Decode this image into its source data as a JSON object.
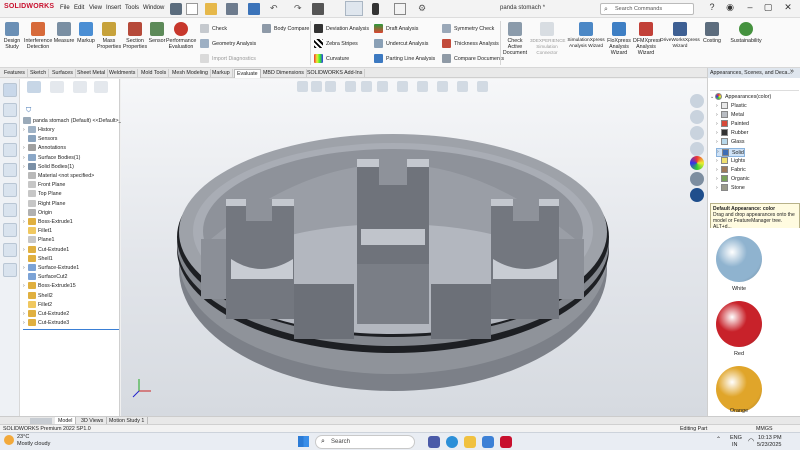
{
  "titlebar": {
    "logo": "SOLIDWORKS",
    "menus": [
      "File",
      "Edit",
      "View",
      "Insert",
      "Tools",
      "Window"
    ],
    "document_title": "panda stomach *",
    "search_placeholder": "Search Commands"
  },
  "ribbon": {
    "large_buttons": [
      {
        "label": "Design\nStudy",
        "icon": "design-study-icon"
      },
      {
        "label": "Interference\nDetection",
        "icon": "interference-icon"
      },
      {
        "label": "Measure",
        "icon": "measure-icon"
      },
      {
        "label": "Markup",
        "icon": "markup-icon"
      },
      {
        "label": "Mass\nProperties",
        "icon": "mass-properties-icon"
      },
      {
        "label": "Section\nProperties",
        "icon": "section-properties-icon"
      },
      {
        "label": "Sensor",
        "icon": "sensor-icon"
      },
      {
        "label": "Performance\nEvaluation",
        "icon": "performance-icon"
      }
    ],
    "small_col1": [
      "Check",
      "Geometry Analysis",
      "Import Diagnostics"
    ],
    "body_compare": "Body Compare",
    "small_col2": [
      "Deviation Analysis",
      "Zebra Stripes",
      "Curvature"
    ],
    "small_col3": [
      "Draft Analysis",
      "Undercut Analysis",
      "Parting Line Analysis"
    ],
    "small_col4": [
      "Symmetry Check",
      "Thickness Analysis",
      "Compare Documents"
    ],
    "large_buttons2": [
      {
        "label": "Check\nActive\nDocument",
        "icon": "check-active-icon"
      },
      {
        "label": "3DEXPERIENCE\nSimulation\nConnector",
        "icon": "3dx-icon"
      },
      {
        "label": "SimulationXpress\nAnalysis Wizard",
        "icon": "simxpress-icon"
      },
      {
        "label": "FloXpress\nAnalysis\nWizard",
        "icon": "floxpress-icon"
      },
      {
        "label": "DFMXpress\nAnalysis\nWizard",
        "icon": "dfmxpress-icon"
      },
      {
        "label": "DriveWorksXpress\nWizard",
        "icon": "driveworks-icon"
      },
      {
        "label": "Costing",
        "icon": "costing-icon"
      },
      {
        "label": "Sustainability",
        "icon": "sustainability-icon"
      }
    ]
  },
  "tabs": [
    "Features",
    "Sketch",
    "Surfaces",
    "Sheet Metal",
    "Weldments",
    "Mold Tools",
    "Mesh Modeling",
    "Markup",
    "Evaluate",
    "MBD Dimensions",
    "SOLIDWORKS Add-Ins"
  ],
  "active_tab": "Evaluate",
  "feature_tree": {
    "root": "panda stomach (Default) <<Default>_",
    "items": [
      {
        "label": "History",
        "arrow": "›"
      },
      {
        "label": "Sensors",
        "arrow": ""
      },
      {
        "label": "Annotations",
        "arrow": "›"
      },
      {
        "label": "Surface Bodies(1)",
        "arrow": "›"
      },
      {
        "label": "Solid Bodies(1)",
        "arrow": "›"
      },
      {
        "label": "Material <not specified>",
        "arrow": ""
      },
      {
        "label": "Front Plane",
        "arrow": ""
      },
      {
        "label": "Top Plane",
        "arrow": ""
      },
      {
        "label": "Right Plane",
        "arrow": ""
      },
      {
        "label": "Origin",
        "arrow": ""
      },
      {
        "label": "Boss-Extrude1",
        "arrow": "›"
      },
      {
        "label": "Fillet1",
        "arrow": ""
      },
      {
        "label": "Plane1",
        "arrow": ""
      },
      {
        "label": "Cut-Extrude1",
        "arrow": "›"
      },
      {
        "label": "Shell1",
        "arrow": ""
      },
      {
        "label": "Surface-Extrude1",
        "arrow": "›"
      },
      {
        "label": "SurfaceCut2",
        "arrow": ""
      },
      {
        "label": "Boss-Extrude15",
        "arrow": "›"
      },
      {
        "label": "Shell2",
        "arrow": ""
      },
      {
        "label": "Fillet2",
        "arrow": ""
      },
      {
        "label": "Cut-Extrude2",
        "arrow": "›"
      },
      {
        "label": "Cut-Extrude3",
        "arrow": "›"
      }
    ]
  },
  "taskpane": {
    "header": "Appearances, Scenes, and Deca...",
    "root": "Appearances(color)",
    "items": [
      "Plastic",
      "Metal",
      "Painted",
      "Rubber",
      "Glass",
      "Solid",
      "Lights",
      "Fabric",
      "Organic",
      "Stone"
    ],
    "selected": "Solid",
    "tooltip_title": "Default Appearance: color",
    "tooltip_body": "Drag and drop appearances onto the model or FeatureManager tree.  ALT+d...",
    "swatches": [
      {
        "label": "White",
        "color": "#8fb3cf"
      },
      {
        "label": "Red",
        "color": "#c8222a"
      },
      {
        "label": "Orange",
        "color": "#e0a52a"
      }
    ]
  },
  "bottom_tabs": [
    "Model",
    "3D Views",
    "Motion Study 1"
  ],
  "status": {
    "left": "SOLIDWORKS Premium 2022 SP1.0",
    "mid": "Editing Part",
    "units": "MMGS"
  },
  "taskbar": {
    "weather_temp": "23°C",
    "weather_desc": "Mostly cloudy",
    "search_placeholder": "Search",
    "lang": "ENG",
    "lang2": "IN",
    "time": "10:13 PM",
    "date": "5/23/2025"
  }
}
